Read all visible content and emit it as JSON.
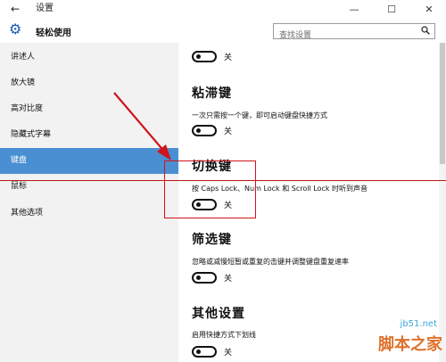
{
  "window": {
    "title": "设置",
    "back_glyph": "←",
    "minimize_glyph": "—",
    "maximize_glyph": "☐",
    "close_glyph": "✕"
  },
  "header": {
    "page_title": "轻松使用",
    "search_placeholder": "查找设置"
  },
  "sidebar": {
    "items": [
      {
        "label": "讲述人",
        "active": false
      },
      {
        "label": "放大镜",
        "active": false
      },
      {
        "label": "高对比度",
        "active": false
      },
      {
        "label": "隐藏式字幕",
        "active": false
      },
      {
        "label": "键盘",
        "active": true
      },
      {
        "label": "鼠标",
        "active": false
      },
      {
        "label": "其他选项",
        "active": false
      }
    ]
  },
  "content": {
    "top_toggle": {
      "label": "关"
    },
    "sections": [
      {
        "heading": "粘滞键",
        "description": "一次只需按一个键，即可启动键盘快捷方式",
        "toggle_label": "关"
      },
      {
        "heading": "切换键",
        "description": "按 Caps Lock、Num Lock 和 Scroll Lock 时听到声音",
        "toggle_label": "关"
      },
      {
        "heading": "筛选键",
        "description": "忽略或减慢短暂或重复的击键并调整键盘重复速率",
        "toggle_label": "关"
      },
      {
        "heading": "其他设置",
        "description": "启用快捷方式下划线",
        "toggle_label": "关"
      }
    ]
  },
  "watermark": {
    "url": "jb51.net",
    "brand": "脚本之家"
  },
  "colors": {
    "accent": "#4a8fd1",
    "annotation_red": "#d0141c",
    "watermark_blue": "#3aa7e0",
    "watermark_orange": "#e0702a"
  }
}
